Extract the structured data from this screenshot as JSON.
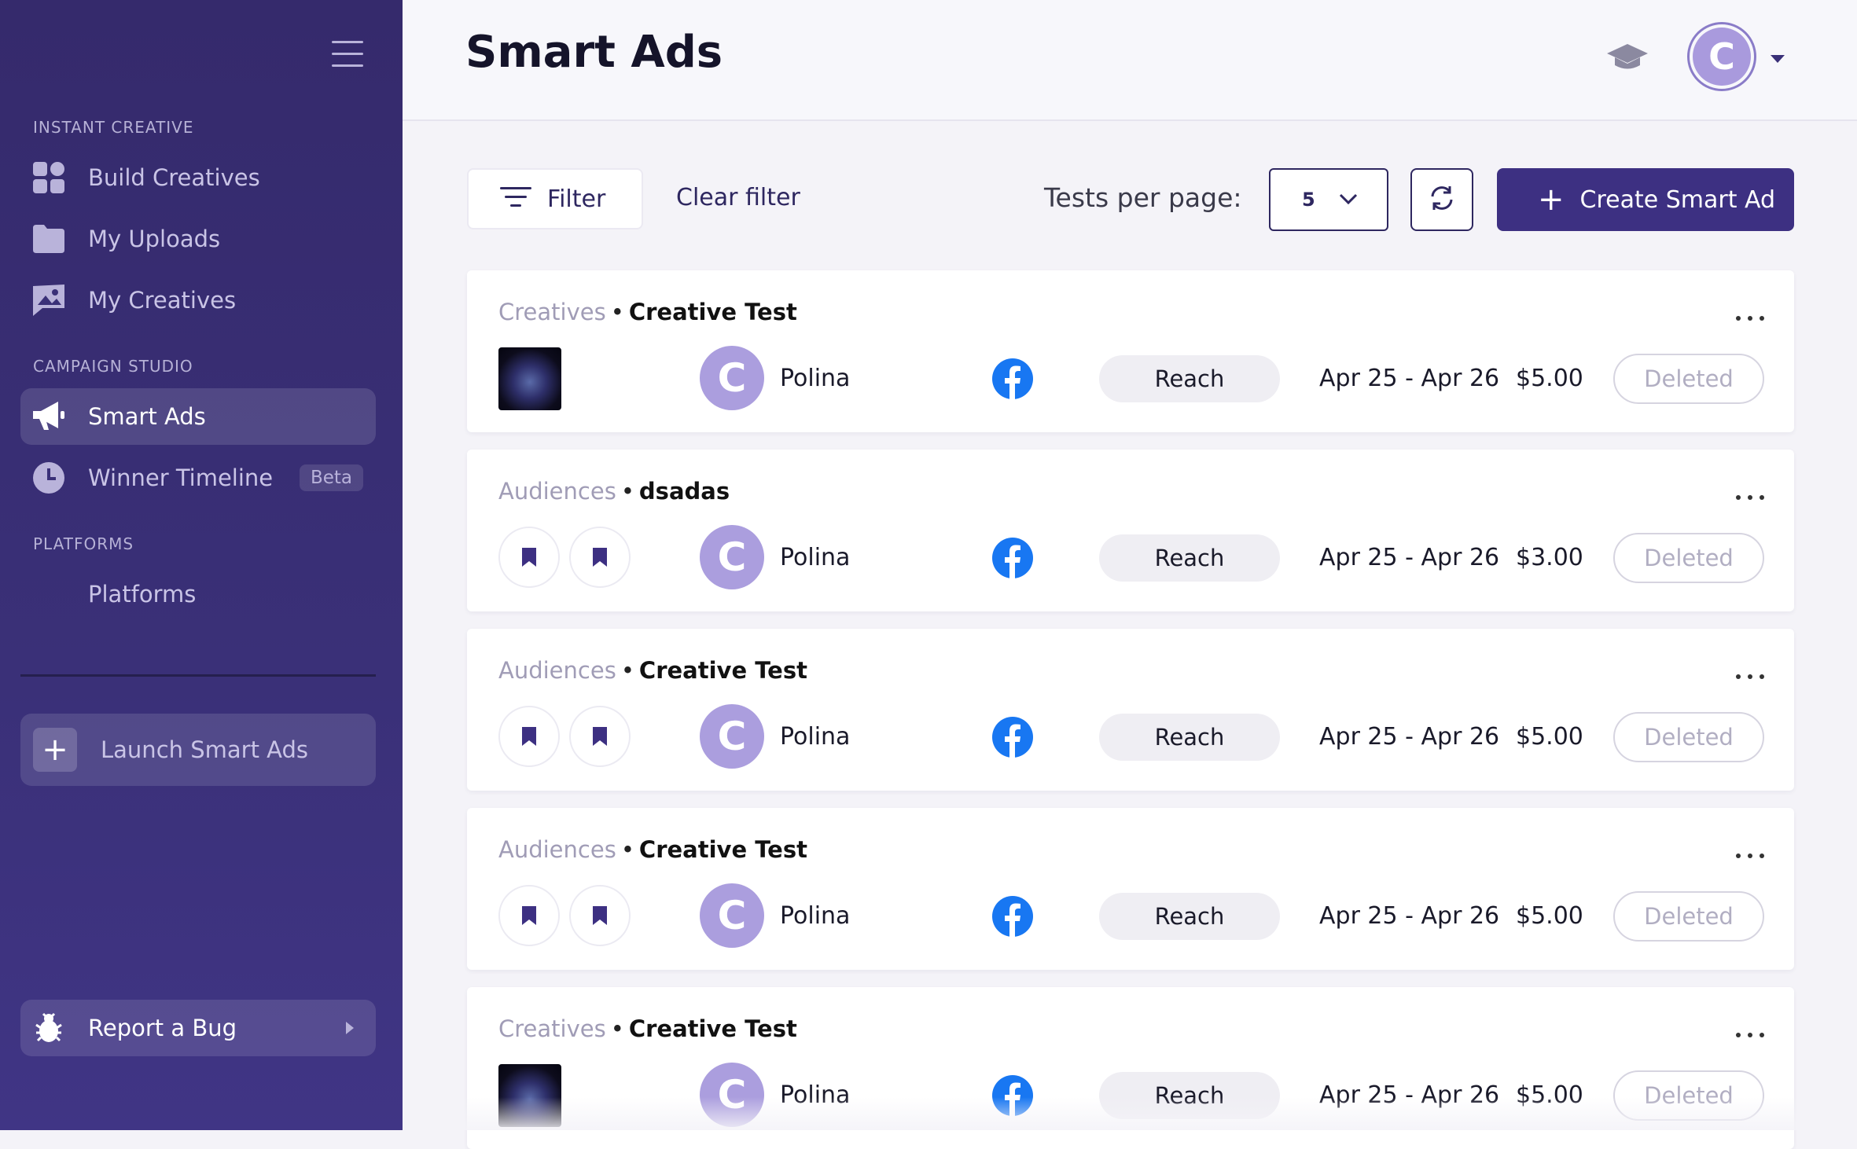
{
  "sidebar": {
    "sections": {
      "instant_creative": "INSTANT CREATIVE",
      "campaign_studio": "CAMPAIGN STUDIO",
      "platforms": "PLATFORMS"
    },
    "items": {
      "build_creatives": "Build Creatives",
      "my_uploads": "My Uploads",
      "my_creatives": "My Creatives",
      "smart_ads": "Smart Ads",
      "winner_timeline": "Winner Timeline",
      "winner_timeline_badge": "Beta",
      "platforms": "Platforms"
    },
    "launch_label": "Launch Smart Ads",
    "bug_label": "Report a Bug"
  },
  "header": {
    "title": "Smart Ads",
    "avatar_initial": "C"
  },
  "toolbar": {
    "filter_label": "Filter",
    "clear_filter_label": "Clear filter",
    "tests_per_page_label": "Tests per page:",
    "tests_per_page_value": "5",
    "create_label": "Create Smart Ad"
  },
  "colors": {
    "sidebar_bg": "#352a6c",
    "primary": "#3d3082",
    "avatar": "#ab9ede",
    "facebook": "#1877f2"
  },
  "ads": [
    {
      "category": "Creatives",
      "name": "Creative Test",
      "user_initial": "C",
      "user": "Polina",
      "objective": "Reach",
      "dates": "Apr 25 - Apr 26",
      "budget": "$5.00",
      "status": "Deleted"
    },
    {
      "category": "Audiences",
      "name": "dsadas",
      "user_initial": "C",
      "user": "Polina",
      "objective": "Reach",
      "dates": "Apr 25 - Apr 26",
      "budget": "$3.00",
      "status": "Deleted"
    },
    {
      "category": "Audiences",
      "name": "Creative Test",
      "user_initial": "C",
      "user": "Polina",
      "objective": "Reach",
      "dates": "Apr 25 - Apr 26",
      "budget": "$5.00",
      "status": "Deleted"
    },
    {
      "category": "Audiences",
      "name": "Creative Test",
      "user_initial": "C",
      "user": "Polina",
      "objective": "Reach",
      "dates": "Apr 25 - Apr 26",
      "budget": "$5.00",
      "status": "Deleted"
    },
    {
      "category": "Creatives",
      "name": "Creative Test",
      "user_initial": "C",
      "user": "Polina",
      "objective": "Reach",
      "dates": "Apr 25 - Apr 26",
      "budget": "$5.00",
      "status": "Deleted"
    }
  ]
}
